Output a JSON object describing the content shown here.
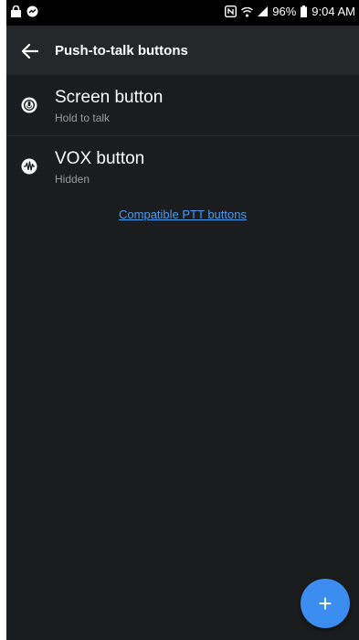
{
  "status_bar": {
    "battery": "96%",
    "time": "9:04 AM",
    "icons_left": [
      "lock-icon",
      "messenger-icon"
    ],
    "icons_right": [
      "nfc-icon",
      "wifi-icon",
      "signal-icon",
      "battery-icon"
    ]
  },
  "app_bar": {
    "title": "Push-to-talk buttons",
    "back_icon": "arrow-left-icon"
  },
  "buttons": [
    {
      "title": "Screen button",
      "subtitle": "Hold to talk",
      "icon": "ptt-screen-icon"
    },
    {
      "title": "VOX button",
      "subtitle": "Hidden",
      "icon": "vox-waveform-icon"
    }
  ],
  "link": {
    "label": "Compatible PTT buttons"
  },
  "fab": {
    "label": "+",
    "icon": "add-icon"
  },
  "colors": {
    "background": "#1b1c1e",
    "app_bar": "#26272a",
    "accent": "#3b8eef",
    "link": "#4a9df2"
  }
}
